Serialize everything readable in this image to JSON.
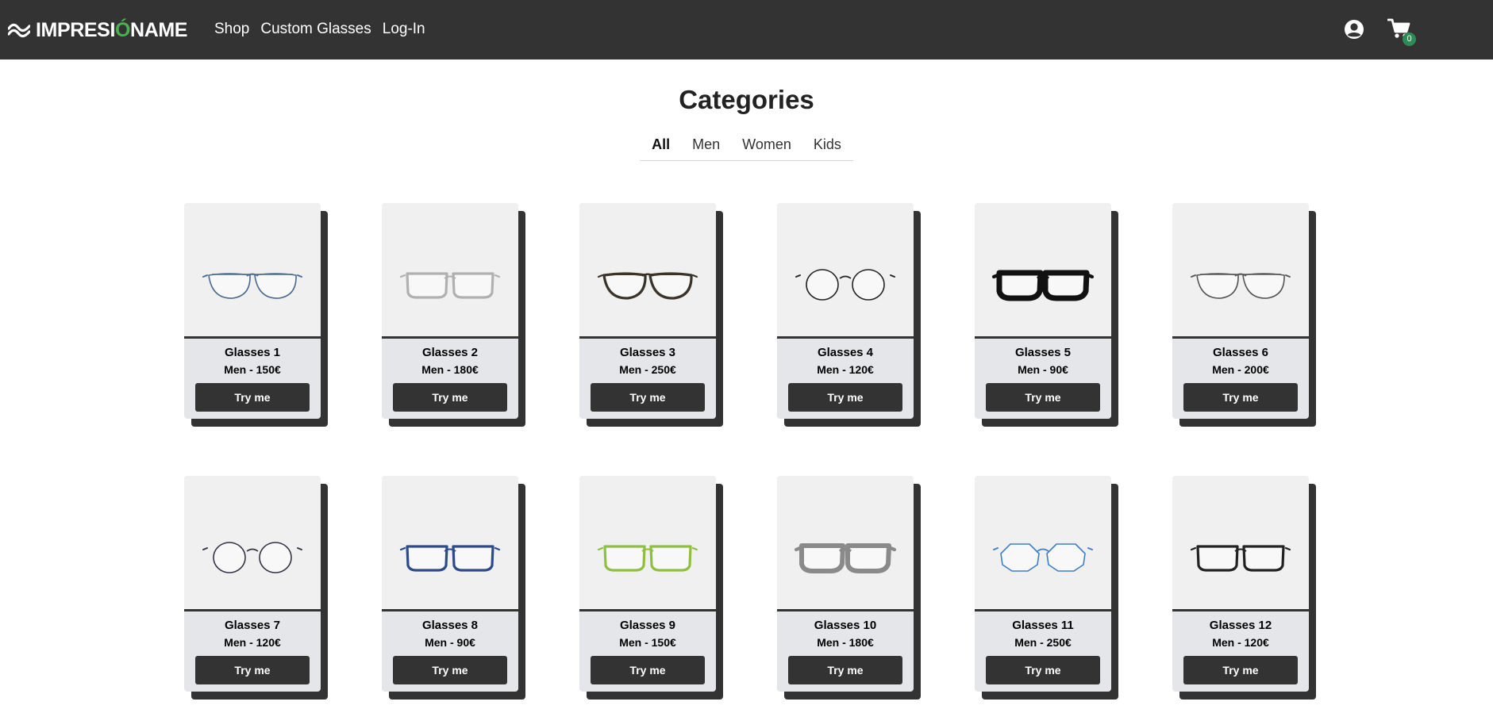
{
  "navbar": {
    "brand_main": "IMPRESI",
    "brand_accent": "Ó",
    "brand_tail": "NAME",
    "brand_icon": "wave-icon",
    "links": [
      {
        "label": "Shop"
      },
      {
        "label": "Custom Glasses"
      },
      {
        "label": "Log-In"
      }
    ],
    "account_icon": "user-circle-icon",
    "cart_icon": "cart-icon",
    "cart_count": "0"
  },
  "categories": {
    "title": "Categories",
    "tabs": [
      {
        "label": "All",
        "active": true
      },
      {
        "label": "Men",
        "active": false
      },
      {
        "label": "Women",
        "active": false
      },
      {
        "label": "Kids",
        "active": false
      }
    ]
  },
  "products": [
    {
      "name": "Glasses 1",
      "price": "Men - 150€",
      "button": "Try me",
      "frame_color": "#4a6a8f",
      "style": "aviator-thin"
    },
    {
      "name": "Glasses 2",
      "price": "Men - 180€",
      "button": "Try me",
      "frame_color": "#b0b0b0",
      "style": "rect"
    },
    {
      "name": "Glasses 3",
      "price": "Men - 250€",
      "button": "Try me",
      "frame_color": "#3a3329",
      "style": "aviator-thick"
    },
    {
      "name": "Glasses 4",
      "price": "Men - 120€",
      "button": "Try me",
      "frame_color": "#222222",
      "style": "round"
    },
    {
      "name": "Glasses 5",
      "price": "Men - 90€",
      "button": "Try me",
      "frame_color": "#111111",
      "style": "flat-top"
    },
    {
      "name": "Glasses 6",
      "price": "Men - 200€",
      "button": "Try me",
      "frame_color": "#555555",
      "style": "aviator-thin"
    },
    {
      "name": "Glasses 7",
      "price": "Men - 120€",
      "button": "Try me",
      "frame_color": "#333344",
      "style": "round"
    },
    {
      "name": "Glasses 8",
      "price": "Men - 90€",
      "button": "Try me",
      "frame_color": "#2d4a8a",
      "style": "rect"
    },
    {
      "name": "Glasses 9",
      "price": "Men - 150€",
      "button": "Try me",
      "frame_color": "#8fbf3f",
      "style": "rect"
    },
    {
      "name": "Glasses 10",
      "price": "Men - 180€",
      "button": "Try me",
      "frame_color": "#8a8a8a",
      "style": "flat-top"
    },
    {
      "name": "Glasses 11",
      "price": "Men - 250€",
      "button": "Try me",
      "frame_color": "#3f7fc8",
      "style": "octagon"
    },
    {
      "name": "Glasses 12",
      "price": "Men - 120€",
      "button": "Try me",
      "frame_color": "#222222",
      "style": "rect"
    }
  ]
}
